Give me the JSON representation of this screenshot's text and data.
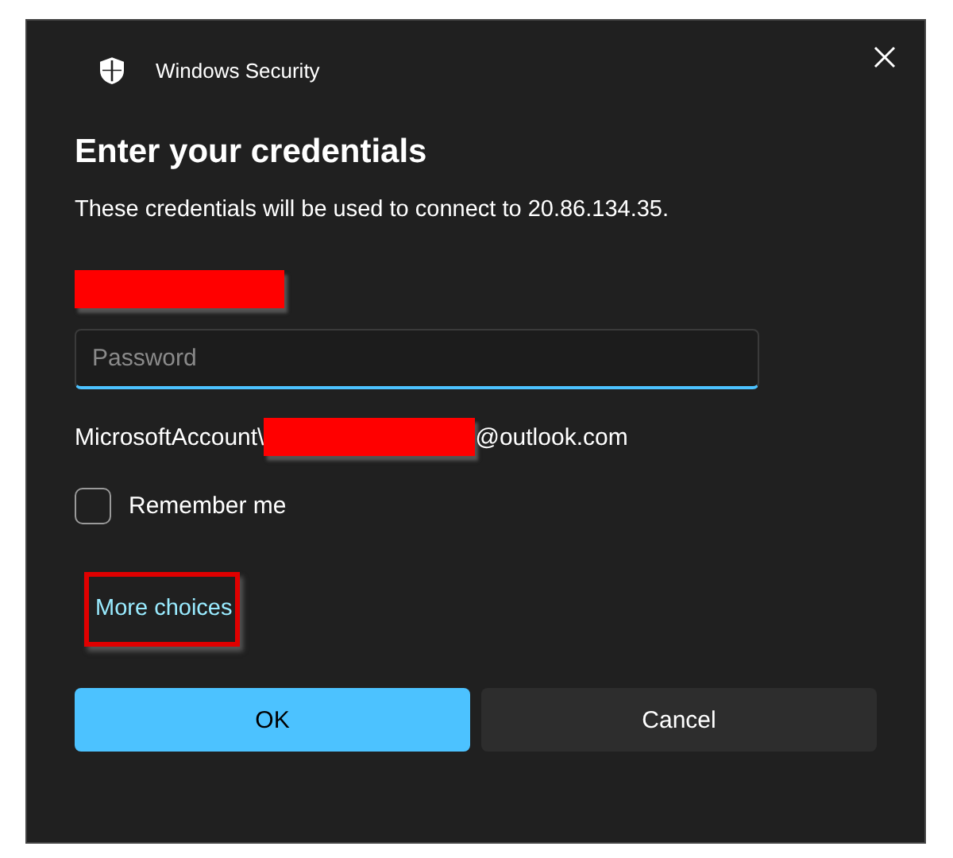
{
  "window": {
    "title": "Windows Security"
  },
  "heading": "Enter your credentials",
  "message": "These credentials will be used to connect to 20.86.134.35.",
  "password": {
    "placeholder": "Password"
  },
  "account": {
    "prefix": "MicrosoftAccount\\",
    "suffix": "@outlook.com"
  },
  "remember": {
    "label": "Remember me",
    "checked": false
  },
  "more_choices": "More choices",
  "buttons": [
    {
      "label": "OK",
      "kind": "primary"
    },
    {
      "label": "Cancel",
      "kind": "secondary"
    }
  ]
}
